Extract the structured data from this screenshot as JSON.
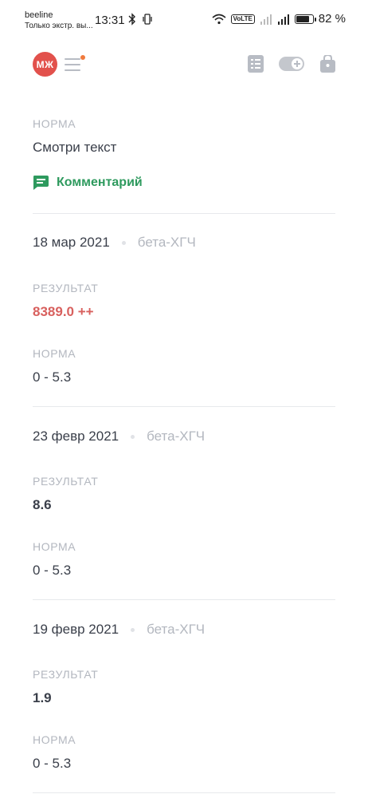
{
  "status_bar": {
    "carrier": "beeline",
    "carrier_sub": "Только экстр. вы...",
    "time": "13:31",
    "battery": "82 %",
    "battery_level": 0.82,
    "volte": "VoLTE"
  },
  "app_bar": {
    "avatar_initials": "МЖ"
  },
  "top_section": {
    "norm_label": "НОРМА",
    "norm_value": "Смотри текст",
    "comment_label": "Комментарий"
  },
  "results": [
    {
      "date": "18 мар 2021",
      "test": "бета-ХГЧ",
      "result_label": "РЕЗУЛЬТАТ",
      "result_value": "8389.0 ++",
      "result_alert": true,
      "norm_label": "НОРМА",
      "norm_value": "0 - 5.3"
    },
    {
      "date": "23 февр 2021",
      "test": "бета-ХГЧ",
      "result_label": "РЕЗУЛЬТАТ",
      "result_value": "8.6",
      "result_alert": false,
      "norm_label": "НОРМА",
      "norm_value": "0 - 5.3"
    },
    {
      "date": "19 февр 2021",
      "test": "бета-ХГЧ",
      "result_label": "РЕЗУЛЬТАТ",
      "result_value": "1.9",
      "result_alert": false,
      "norm_label": "НОРМА",
      "norm_value": "0 - 5.3"
    }
  ],
  "colors": {
    "accent_green": "#2e9a5e",
    "alert_red": "#d8605e",
    "avatar_bg": "#e2514c",
    "notification_dot": "#f07a3d"
  },
  "icons": [
    "bluetooth-icon",
    "vibrate-icon",
    "wifi-icon",
    "signal-icon",
    "battery-icon",
    "menu-icon",
    "list-icon",
    "toggle-add-icon",
    "bag-icon",
    "comment-icon"
  ]
}
